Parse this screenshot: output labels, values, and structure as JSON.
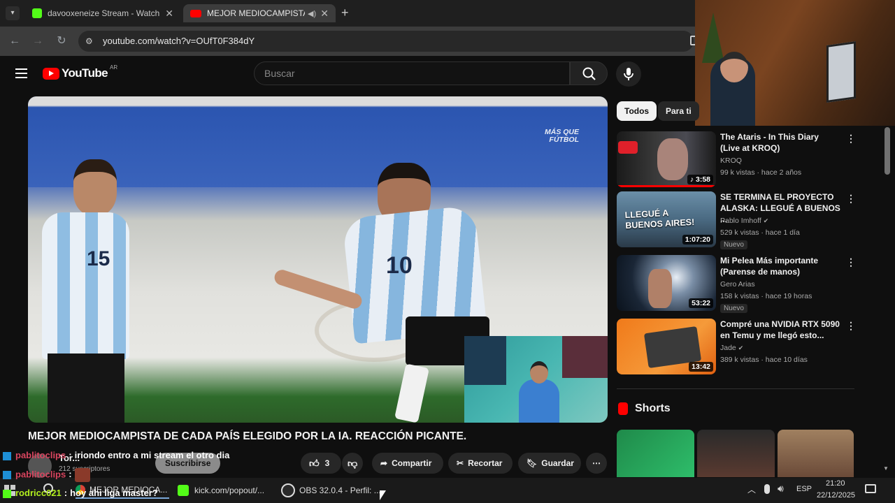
{
  "browser": {
    "tabs": [
      {
        "label": "davooxeneize Stream - Watch L",
        "close": "✕"
      },
      {
        "label": "MEJOR MEDIOCAMPISTA D",
        "close": "✕"
      }
    ],
    "new_tab": "+",
    "url": "youtube.com/watch?v=OUfT0F384dY"
  },
  "youtube": {
    "logo": "YouTube",
    "region": "AR",
    "search_placeholder": "Buscar",
    "video": {
      "overlay_logo": "MÁS QUE FÚTBOL",
      "title": "MEJOR MEDIOCAMPISTA DE CADA PAÍS ELEGIDO POR LA IA. REACCIÓN PICANTE.",
      "channel_name": "Tor...",
      "subscribers": "212 suscriptores",
      "subscribe_label": "Suscribirse",
      "likes": "3",
      "actions": {
        "share": "Compartir",
        "clip": "Recortar",
        "save": "Guardar"
      }
    },
    "chips": [
      "Todos",
      "Para ti"
    ],
    "recommendations": [
      {
        "title": "The Ataris - In This Diary (Live at KROQ)",
        "channel": "KROQ",
        "meta": "99 k vistas · hace 2 años",
        "duration": "3:58",
        "badge": ""
      },
      {
        "title": "SE TERMINA EL PROYECTO ALASKA: LLEGUÉ A BUENOS ...",
        "channel": "Pablo Imhoff",
        "meta": "529 k vistas · hace 1 día",
        "duration": "1:07:20",
        "badge": "Nuevo",
        "thumb_text": "LLEGUÉ A BUENOS AIRES!"
      },
      {
        "title": "Mi Pelea Más importante (Parense de manos)",
        "channel": "Gero Arias",
        "meta": "158 k vistas · hace 19 horas",
        "duration": "53:22",
        "badge": "Nuevo"
      },
      {
        "title": "Compré una NVIDIA RTX 5090 en Temu y me llegó esto...",
        "channel": "Jade",
        "meta": "389 k vistas · hace 10 días",
        "duration": "13:42",
        "badge": ""
      }
    ],
    "shorts_label": "Shorts"
  },
  "chat": [
    {
      "user": "pablitoclips",
      "sep": ":",
      "text": "iriondo entro a mi stream el otro dia"
    },
    {
      "user": "pablitoclips",
      "sep": ":",
      "text": ""
    },
    {
      "user": "rodricc021",
      "sep": ":",
      "text": "hoy ahi liga master?"
    }
  ],
  "taskbar": {
    "items": [
      "MEJOR MEDIOCA...",
      "kick.com/popout/...",
      "OBS 32.0.4 - Perfil: ..."
    ],
    "language": "ESP",
    "time": "21:20",
    "date": "22/12/2025"
  },
  "colors": {
    "youtube_red": "#ff0000",
    "kick_green": "#53fc18",
    "background": "#0f0f0f"
  }
}
